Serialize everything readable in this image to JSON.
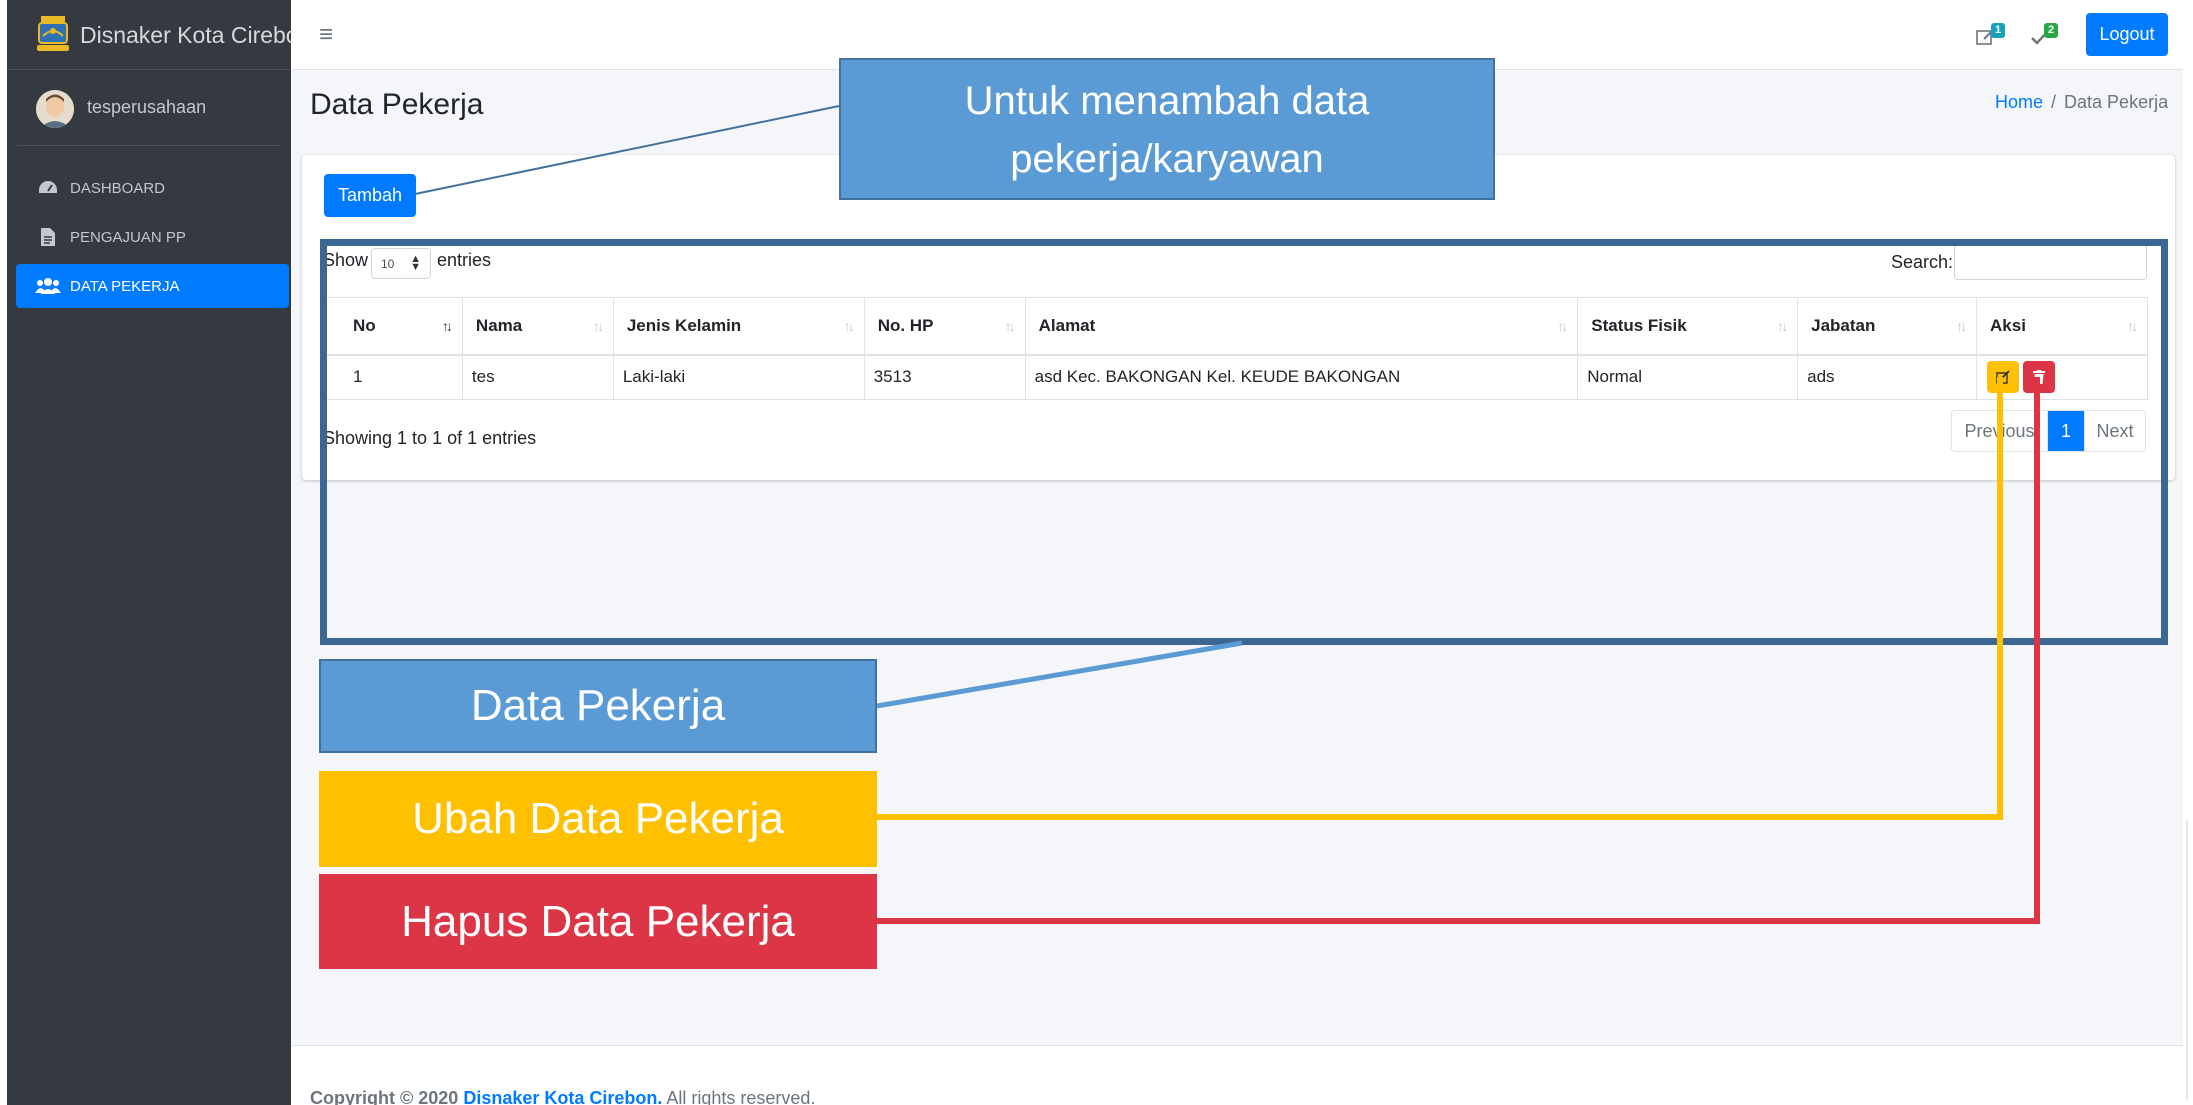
{
  "sidebar": {
    "brand": "Disnaker Kota Cirebon",
    "user": "tesperusahaan",
    "items": [
      {
        "label": "DASHBOARD",
        "icon": "tachometer-icon"
      },
      {
        "label": "PENGAJUAN PP",
        "icon": "file-icon"
      },
      {
        "label": "DATA PEKERJA",
        "icon": "users-icon",
        "active": true
      }
    ]
  },
  "topnav": {
    "notif_1_count": "1",
    "notif_2_count": "2",
    "logout_label": "Logout"
  },
  "header": {
    "title": "Data Pekerja",
    "breadcrumb_home": "Home",
    "breadcrumb_sep": "/",
    "breadcrumb_current": "Data Pekerja"
  },
  "main": {
    "add_button": "Tambah",
    "show_label": "Show",
    "show_value": "10",
    "entries_label": "entries",
    "search_label": "Search:",
    "search_value": "",
    "columns": [
      "No",
      "Nama",
      "Jenis Kelamin",
      "No. HP",
      "Alamat",
      "Status Fisik",
      "Jabatan",
      "Aksi"
    ],
    "rows": [
      {
        "no": "1",
        "nama": "tes",
        "jenis_kelamin": "Laki-laki",
        "no_hp": "3513",
        "alamat": "asd Kec. BAKONGAN Kel. KEUDE BAKONGAN",
        "status_fisik": "Normal",
        "jabatan": "ads"
      }
    ],
    "info": "Showing 1 to 1 of 1 entries",
    "pager_prev": "Previous",
    "pager_current": "1",
    "pager_next": "Next"
  },
  "footer": {
    "copyright": "Copyright © 2020",
    "org": "Disnaker Kota Cirebon.",
    "rights": "All rights reserved."
  },
  "annotations": {
    "add_callout": "Untuk menambah data pekerja/karyawan",
    "data_label": "Data Pekerja",
    "edit_label": "Ubah Data Pekerja",
    "delete_label": "Hapus Data Pekerja"
  },
  "colors": {
    "primary": "#007bff",
    "sidebar": "#343a40",
    "warning": "#ffc107",
    "danger": "#dc3545",
    "callout_blue": "#5b9bd5",
    "frame_blue": "#3d6793",
    "label_yellow": "#ffc000"
  }
}
